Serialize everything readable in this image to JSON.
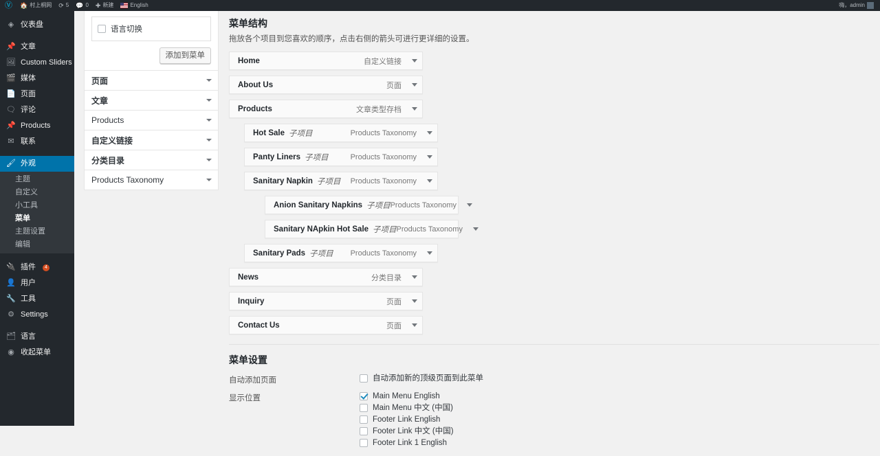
{
  "adminbar": {
    "logo_icon": "wordpress-logo-icon",
    "site_icon": "home-icon",
    "site_name": "村上桐网",
    "updates_icon": "updates-icon",
    "updates_count": "5",
    "comments_icon": "comment-bubble-icon",
    "comments_count": "0",
    "new_icon": "plus-icon",
    "new_label": "新建",
    "lang_flag_icon": "us-flag-icon",
    "lang_label": "English",
    "account_label": "嗨，admin",
    "avatar_icon": "avatar-icon"
  },
  "adminmenu": {
    "items": [
      {
        "label": "仪表盘",
        "icon": "dashboard-icon"
      },
      {
        "label": "文章",
        "icon": "pin-icon"
      },
      {
        "label": "Custom Sliders",
        "icon": "slides-icon"
      },
      {
        "label": "媒体",
        "icon": "media-icon"
      },
      {
        "label": "页面",
        "icon": "page-icon"
      },
      {
        "label": "评论",
        "icon": "comment-icon"
      },
      {
        "label": "Products",
        "icon": "pin-icon"
      },
      {
        "label": "联系",
        "icon": "email-icon"
      }
    ],
    "appearance": {
      "label": "外观",
      "icon": "brush-icon"
    },
    "appearance_sub": [
      {
        "label": "主题"
      },
      {
        "label": "自定义"
      },
      {
        "label": "小工具"
      },
      {
        "label": "菜单"
      },
      {
        "label": "主题设置"
      },
      {
        "label": "编辑"
      }
    ],
    "items_bottom": [
      {
        "label": "插件",
        "icon": "plugins-icon",
        "badge": "4"
      },
      {
        "label": "用户",
        "icon": "users-icon"
      },
      {
        "label": "工具",
        "icon": "tools-icon"
      },
      {
        "label": "Settings",
        "icon": "settings-icon"
      }
    ],
    "items_tail": [
      {
        "label": "语言",
        "icon": "language-icon"
      },
      {
        "label": "收起菜单",
        "icon": "collapse-icon"
      }
    ]
  },
  "add_panel": {
    "checkbox_label": "语言切换",
    "checkbox_checked": false,
    "add_button": "添加到菜单"
  },
  "accordion": [
    {
      "label": "页面",
      "bold": true
    },
    {
      "label": "文章",
      "bold": true
    },
    {
      "label": "Products",
      "bold": false
    },
    {
      "label": "自定义链接",
      "bold": true
    },
    {
      "label": "分类目录",
      "bold": true
    },
    {
      "label": "Products Taxonomy",
      "bold": false
    }
  ],
  "structure": {
    "title": "菜单结构",
    "description": "拖放各个项目到您喜欢的顺序，点击右侧的箭头可进行更详细的设置。",
    "items": [
      {
        "title": "Home",
        "sub": "",
        "type": "自定义链接",
        "depth": 0
      },
      {
        "title": "About Us",
        "sub": "",
        "type": "页面",
        "depth": 0
      },
      {
        "title": "Products",
        "sub": "",
        "type": "文章类型存档",
        "depth": 0
      },
      {
        "title": "Hot Sale",
        "sub": "子项目",
        "type": "Products Taxonomy",
        "depth": 1
      },
      {
        "title": "Panty Liners",
        "sub": "子项目",
        "type": "Products Taxonomy",
        "depth": 1
      },
      {
        "title": "Sanitary Napkin",
        "sub": "子项目",
        "type": "Products Taxonomy",
        "depth": 1
      },
      {
        "title": "Anion Sanitary Napkins",
        "sub": "子项目",
        "type": "Products Taxonomy",
        "depth": 2
      },
      {
        "title": "Sanitary NApkin Hot Sale",
        "sub": "子项目",
        "type": "Products Taxonomy",
        "depth": 2
      },
      {
        "title": "Sanitary Pads",
        "sub": "子项目",
        "type": "Products Taxonomy",
        "depth": 1
      },
      {
        "title": "News",
        "sub": "",
        "type": "分类目录",
        "depth": 0
      },
      {
        "title": "Inquiry",
        "sub": "",
        "type": "页面",
        "depth": 0
      },
      {
        "title": "Contact Us",
        "sub": "",
        "type": "页面",
        "depth": 0
      }
    ]
  },
  "settings": {
    "title": "菜单设置",
    "auto_add_label": "自动添加页面",
    "auto_add_checkbox_label": "自动添加新的顶级页面到此菜单",
    "auto_add_checked": false,
    "display_location_label": "显示位置",
    "locations": [
      {
        "label": "Main Menu English",
        "checked": true
      },
      {
        "label": "Main Menu 中文 (中国)",
        "checked": false
      },
      {
        "label": "Footer Link English",
        "checked": false
      },
      {
        "label": "Footer Link 中文 (中国)",
        "checked": false
      },
      {
        "label": "Footer Link 1 English",
        "checked": false
      }
    ]
  },
  "colors": {
    "admin_bg": "#23282d",
    "accent": "#0073aa",
    "badge": "#d54e21",
    "page_bg": "#f1f1f1"
  }
}
